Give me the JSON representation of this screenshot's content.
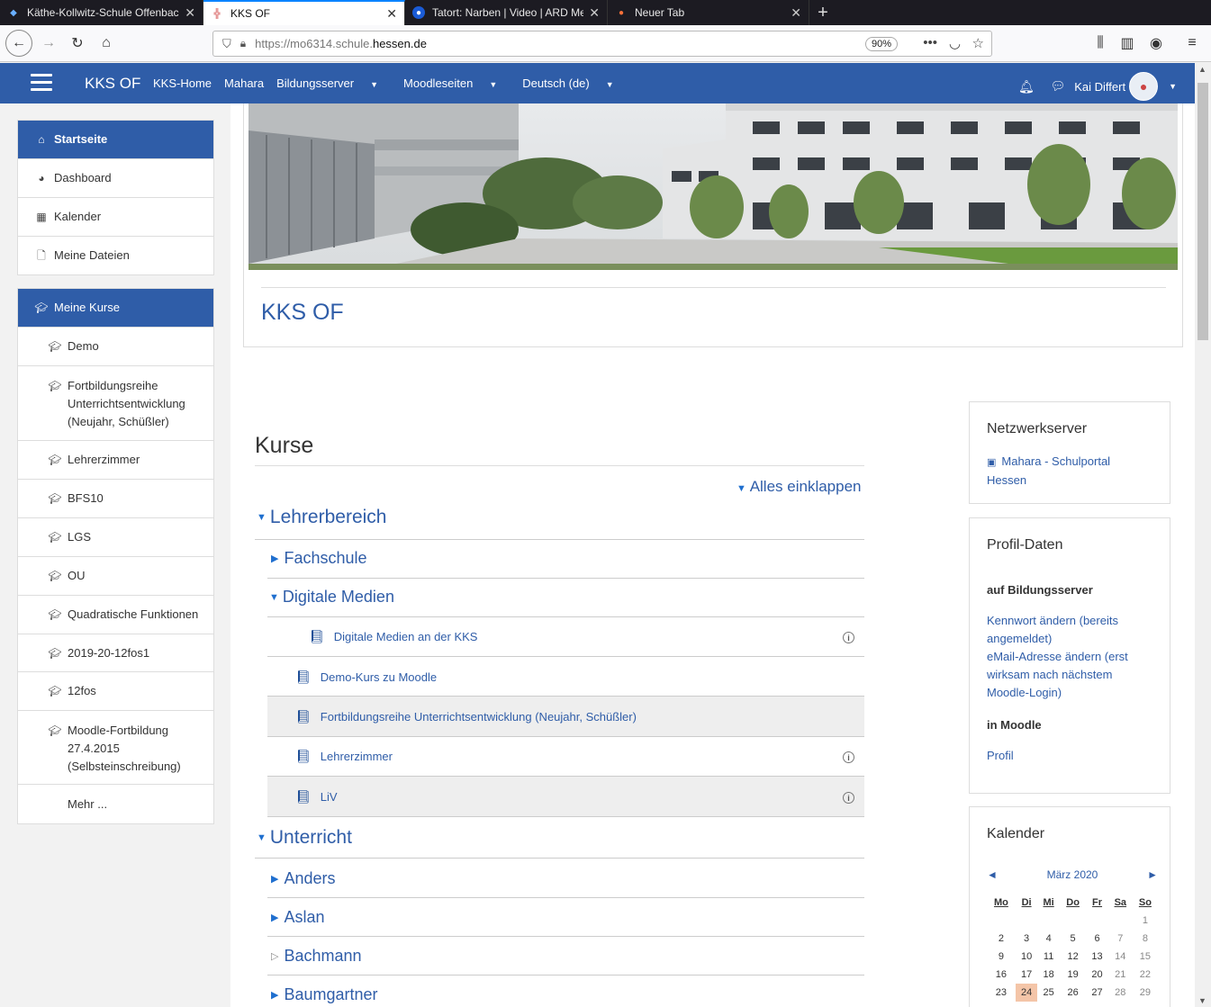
{
  "browser": {
    "tabs": [
      {
        "title": "Käthe-Kollwitz-Schule Offenbach",
        "active": false
      },
      {
        "title": "KKS OF",
        "active": true
      },
      {
        "title": "Tatort: Narben | Video | ARD Mediathek",
        "active": false
      },
      {
        "title": "Neuer Tab",
        "active": false
      }
    ],
    "url_prefix": "https://mo6314.schule.",
    "url_domain": "hessen.de",
    "zoom": "90%"
  },
  "header": {
    "brand": "KKS OF",
    "nav": [
      "KKS-Home",
      "Mahara",
      "Bildungsserver",
      "Moodleseiten",
      "Deutsch (de)"
    ],
    "user": "Kai Differt"
  },
  "drawer": {
    "top": [
      {
        "label": "Startseite",
        "icon": "home-icon"
      },
      {
        "label": "Dashboard",
        "icon": "dashboard-icon"
      },
      {
        "label": "Kalender",
        "icon": "calendar-icon"
      },
      {
        "label": "Meine Dateien",
        "icon": "file-icon"
      }
    ],
    "courses_head": "Meine Kurse",
    "courses": [
      "Demo",
      "Fortbildungsreihe Unterrichtsentwicklung (Neujahr, Schüßler)",
      "Lehrerzimmer",
      "BFS10",
      "LGS",
      "OU",
      "Quadratische Funktionen",
      "2019-20-12fos1",
      "12fos",
      "Moodle-Fortbildung 27.4.2015 (Selbsteinschreibung)"
    ],
    "more": "Mehr ..."
  },
  "main": {
    "site_title": "KKS OF",
    "kurse_title": "Kurse",
    "collapse_all": "Alles einklappen",
    "categories": {
      "lehrer": "Lehrerbereich",
      "fachschule": "Fachschule",
      "digitale": "Digitale Medien",
      "unterricht": "Unterricht",
      "anders": "Anders",
      "aslan": "Aslan",
      "bachmann": "Bachmann",
      "baumgartner": "Baumgartner"
    },
    "courses": [
      "Digitale Medien an der KKS",
      "Demo-Kurs zu Moodle",
      "Fortbildungsreihe Unterrichtsentwicklung (Neujahr, Schüßler)",
      "Lehrerzimmer",
      "LiV"
    ]
  },
  "right": {
    "netz_title": "Netzwerkserver",
    "netz_link": "Mahara - Schulportal Hessen",
    "profil_title": "Profil-Daten",
    "profil_bildung": "auf Bildungsserver",
    "profil_kennwort": "Kennwort ändern (bereits angemeldet)",
    "profil_email": "eMail-Adresse ändern (erst wirksam nach nächstem Moodle-Login)",
    "profil_moodle": "in Moodle",
    "profil_link": "Profil",
    "cal_title": "Kalender",
    "cal_month": "März 2020",
    "cal_days": [
      "Mo",
      "Di",
      "Mi",
      "Do",
      "Fr",
      "Sa",
      "So"
    ],
    "cal_weeks": [
      [
        "",
        "",
        "",
        "",
        "",
        "",
        "1"
      ],
      [
        "2",
        "3",
        "4",
        "5",
        "6",
        "7",
        "8"
      ],
      [
        "9",
        "10",
        "11",
        "12",
        "13",
        "14",
        "15"
      ],
      [
        "16",
        "17",
        "18",
        "19",
        "20",
        "21",
        "22"
      ],
      [
        "23",
        "24",
        "25",
        "26",
        "27",
        "28",
        "29"
      ]
    ],
    "cal_today": "24"
  }
}
